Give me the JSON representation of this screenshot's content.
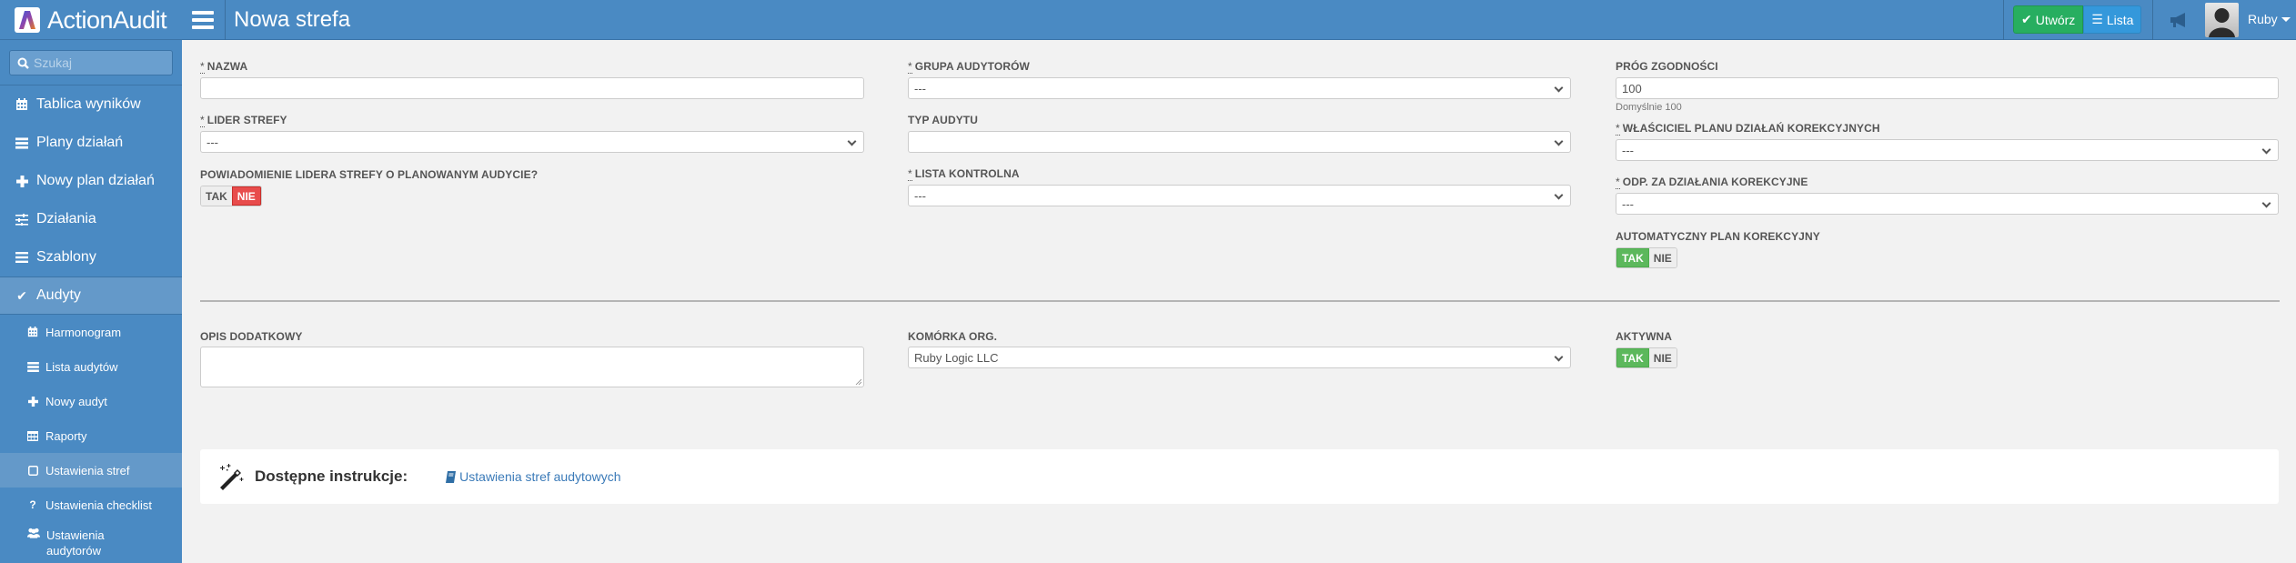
{
  "header": {
    "app_name": "ActionAudit",
    "page_title": "Nowa strefa",
    "create_button": "Utwórz",
    "list_button": "Lista",
    "user_name": "Ruby",
    "icons": {
      "menu": "hamburger-icon",
      "create": "check-icon",
      "list": "list-icon",
      "announcements": "megaphone-icon",
      "user_menu": "caret-down-icon"
    }
  },
  "sidebar": {
    "search_placeholder": "Szukaj",
    "items": [
      {
        "label": "Tablica wyników",
        "icon": "calendar-icon",
        "active": false
      },
      {
        "label": "Plany działań",
        "icon": "list-alt-icon",
        "active": false
      },
      {
        "label": "Nowy plan działań",
        "icon": "plus-icon",
        "active": false
      },
      {
        "label": "Działania",
        "icon": "sliders-icon",
        "active": false
      },
      {
        "label": "Szablony",
        "icon": "bars-icon",
        "active": false
      },
      {
        "label": "Audyty",
        "icon": "check-icon",
        "active": true
      }
    ],
    "sub_items": [
      {
        "label": "Harmonogram",
        "icon": "calendar-icon",
        "active": false
      },
      {
        "label": "Lista audytów",
        "icon": "list-alt-icon",
        "active": false
      },
      {
        "label": "Nowy audyt",
        "icon": "plus-icon",
        "active": false
      },
      {
        "label": "Raporty",
        "icon": "table-icon",
        "active": false
      },
      {
        "label": "Ustawienia stref",
        "icon": "square-icon",
        "active": true
      },
      {
        "label": "Ustawienia checklist",
        "icon": "question-icon",
        "active": false
      },
      {
        "label": "Ustawienia audytorów",
        "icon": "users-icon",
        "active": false
      }
    ]
  },
  "form": {
    "required_mark": "*",
    "name": {
      "label": "NAZWA",
      "value": ""
    },
    "zone_leader": {
      "label": "LIDER STREFY",
      "value": "---"
    },
    "notify_leader": {
      "label": "POWIADOMIENIE LIDERA STREFY O PLANOWANYM AUDYCIE?",
      "yes": "TAK",
      "no": "NIE",
      "selected": "NIE"
    },
    "auditor_group": {
      "label": "GRUPA AUDYTORÓW",
      "value": "---"
    },
    "audit_type": {
      "label": "TYP AUDYTU",
      "value": ""
    },
    "checklist": {
      "label": "LISTA KONTROLNA",
      "value": "---"
    },
    "compliance_threshold": {
      "label": "PRÓG ZGODNOŚCI",
      "value": "100",
      "help": "Domyślnie 100"
    },
    "corrective_plan_owner": {
      "label": "WŁAŚCICIEL PLANU DZIAŁAŃ KOREKCYJNYCH",
      "value": "---"
    },
    "corrective_responsible": {
      "label": "ODP. ZA DZIAŁANIA KOREKCYJNE",
      "value": "---"
    },
    "auto_corrective_plan": {
      "label": "AUTOMATYCZNY PLAN KOREKCYJNY",
      "yes": "TAK",
      "no": "NIE",
      "selected": "TAK"
    },
    "description": {
      "label": "OPIS DODATKOWY",
      "value": ""
    },
    "org_unit": {
      "label": "KOMÓRKA ORG.",
      "value": "Ruby Logic LLC"
    },
    "active": {
      "label": "AKTYWNA",
      "yes": "TAK",
      "no": "NIE",
      "selected": "TAK"
    }
  },
  "instructions": {
    "title": "Dostępne instrukcje:",
    "link": "Ustawienia stref audytowych",
    "icon": "magic-wand-icon",
    "link_icon": "book-icon"
  },
  "colors": {
    "header_bg": "#4a8ac3",
    "active_item": "#6499c9",
    "create_green": "#27ae60",
    "list_blue": "#3498db",
    "toggle_yes": "#5cb85c",
    "toggle_no": "#e84c4c",
    "link": "#3a7ab8"
  }
}
